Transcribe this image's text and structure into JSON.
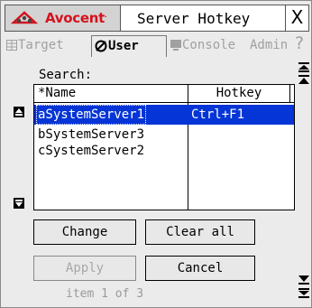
{
  "window": {
    "logo_text": "Avocent",
    "logo_tm": ".",
    "title": "Server Hotkey",
    "close_label": "X"
  },
  "tabs": [
    {
      "label": "Target",
      "active": false
    },
    {
      "label": "User",
      "active": true
    },
    {
      "label": "Console",
      "active": false
    },
    {
      "label": "Admin",
      "active": false
    }
  ],
  "help_label": "?",
  "search": {
    "label": "Search:"
  },
  "table": {
    "columns": [
      "*Name",
      "Hotkey"
    ],
    "rows": [
      {
        "name": "aSystemServer1",
        "hotkey": "Ctrl+F1",
        "selected": true
      },
      {
        "name": "bSystemServer3",
        "hotkey": "",
        "selected": false
      },
      {
        "name": "cSystemServer2",
        "hotkey": "",
        "selected": false
      }
    ]
  },
  "buttons": {
    "change": "Change",
    "clear_all": "Clear all",
    "apply": "Apply",
    "cancel": "Cancel"
  },
  "status": "item 1 of 3",
  "colors": {
    "selection": "#0535d6",
    "logo": "#d4121e",
    "disabled_text": "#a0a0a0"
  },
  "icons": {
    "logo": "avocent-logo-icon",
    "target_tab": "grid-icon",
    "user_tab": "user-icon",
    "console_tab": "monitor-icon",
    "scroll_top": "scroll-to-top-icon",
    "scroll_up": "scroll-up-icon",
    "scroll_down": "scroll-down-icon",
    "scroll_bottom": "scroll-to-bottom-icon"
  }
}
